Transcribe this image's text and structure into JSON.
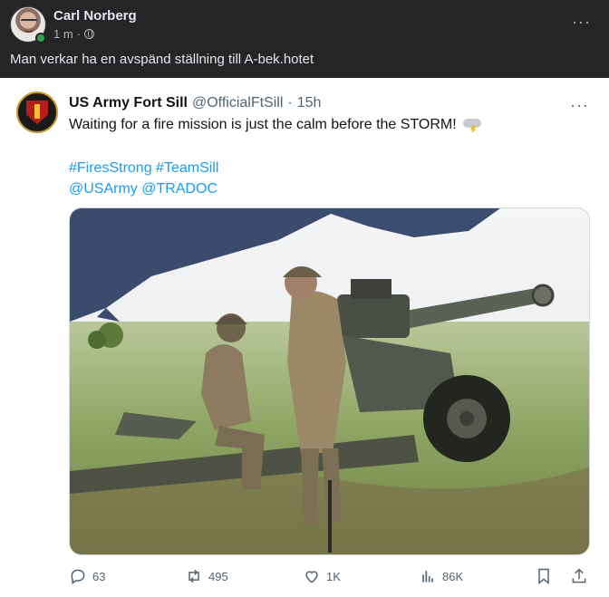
{
  "post": {
    "author": "Carl Norberg",
    "time": "1 m",
    "separator": "·",
    "text": "Man verkar ha en avspänd ställning till A-bek.hotet",
    "more": "···"
  },
  "tweet": {
    "name": "US Army Fort Sill",
    "handle": "@OfficialFtSill",
    "separator": "·",
    "time": "15h",
    "text": "Waiting for a fire mission is just the calm before the STORM!",
    "hashtags": [
      "#FiresStrong",
      "#TeamSill"
    ],
    "mentions": [
      "@USArmy",
      "@TRADOC"
    ],
    "more": "···",
    "stats": {
      "replies": "63",
      "reposts": "495",
      "likes": "1K",
      "views": "86K"
    }
  },
  "icons": {
    "globe": "globe-icon",
    "reply": "reply-icon",
    "repost": "repost-icon",
    "like": "heart-icon",
    "views": "views-icon",
    "bookmark": "bookmark-icon",
    "share": "share-icon",
    "storm": "cloud-lightning-icon"
  },
  "colors": {
    "fb_background": "#242526",
    "fb_text": "#e4e6eb",
    "fb_secondary": "#b0b3b8",
    "online": "#31a24c",
    "tweet_link": "#1d9bf0",
    "tweet_secondary": "#536471"
  }
}
